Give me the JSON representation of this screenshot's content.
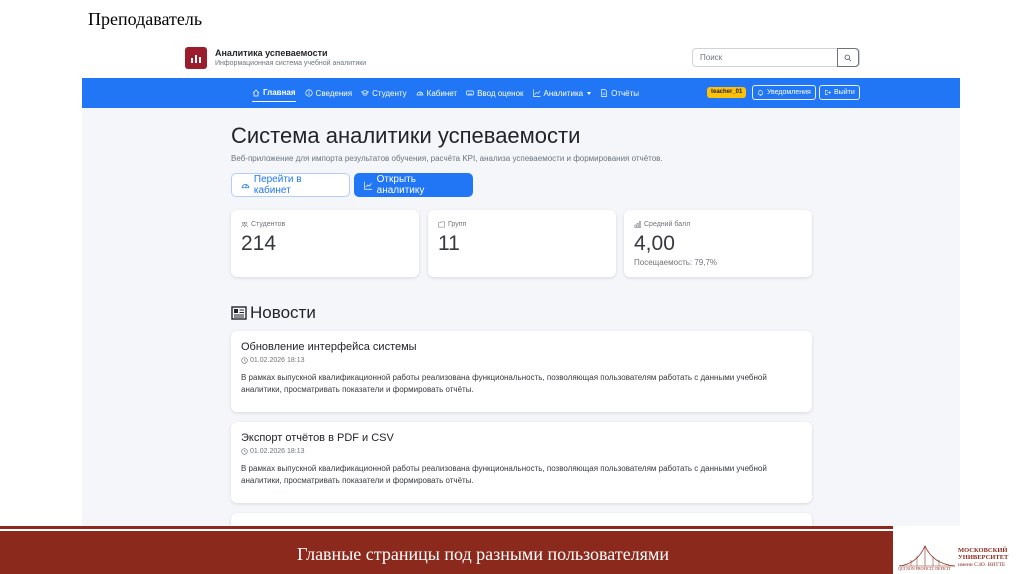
{
  "slide": {
    "title": "Преподаватель",
    "footer": "Главные страницы под разными пользователями"
  },
  "university": {
    "name_line1": "МОСКОВСКИЙ",
    "name_line2": "УНИВЕРСИТЕТ",
    "name_line3": "имени С.Ю. ВИТТЕ",
    "motto": "QUI NON PROFICIT, DEFICIT"
  },
  "app": {
    "name": "Аналитика успеваемости",
    "subtitle": "Информационная система учебной аналитики",
    "logo_color": "#9b1c2c"
  },
  "search": {
    "placeholder": "Поиск"
  },
  "nav": {
    "accent": "#2176f5",
    "items": [
      {
        "label": "Главная",
        "icon": "home-icon",
        "active": true
      },
      {
        "label": "Сведения",
        "icon": "info-icon"
      },
      {
        "label": "Студенту",
        "icon": "graduation-cap-icon"
      },
      {
        "label": "Кабинет",
        "icon": "dashboard-icon"
      },
      {
        "label": "Ввод оценок",
        "icon": "keyboard-icon"
      },
      {
        "label": "Аналитика",
        "icon": "graph-up-icon",
        "dropdown": true
      },
      {
        "label": "Отчёты",
        "icon": "document-icon"
      }
    ],
    "user": "teacher_01",
    "notifications": "Уведомления",
    "logout": "Выйти"
  },
  "hero": {
    "title": "Система аналитики успеваемости",
    "subtitle": "Веб-приложение для импорта результатов обучения, расчёта KPI, анализа успеваемости и формирования отчётов.",
    "btn_cabinet": "Перейти в кабинет",
    "btn_analytics": "Открыть аналитику"
  },
  "stats": [
    {
      "label": "Студентов",
      "value": "214",
      "icon": "people-icon"
    },
    {
      "label": "Групп",
      "value": "11",
      "icon": "folder-icon"
    },
    {
      "label": "Средний балл",
      "value": "4,00",
      "extra": "Посещаемость: 79,7%",
      "icon": "bar-chart-icon"
    }
  ],
  "news": {
    "heading": "Новости",
    "items": [
      {
        "title": "Обновление интерфейса системы",
        "date": "01.02.2026 18:13",
        "text": "В рамках выпускной квалификационной работы реализована функциональность, позволяющая пользователям работать с данными учебной аналитики, просматривать показатели и формировать отчёты."
      },
      {
        "title": "Экспорт отчётов в PDF и CSV",
        "date": "01.02.2026 18:13",
        "text": "В рамках выпускной квалификационной работы реализована функциональность, позволяющая пользователям работать с данными учебной аналитики, просматривать показатели и формировать отчёты."
      }
    ]
  }
}
